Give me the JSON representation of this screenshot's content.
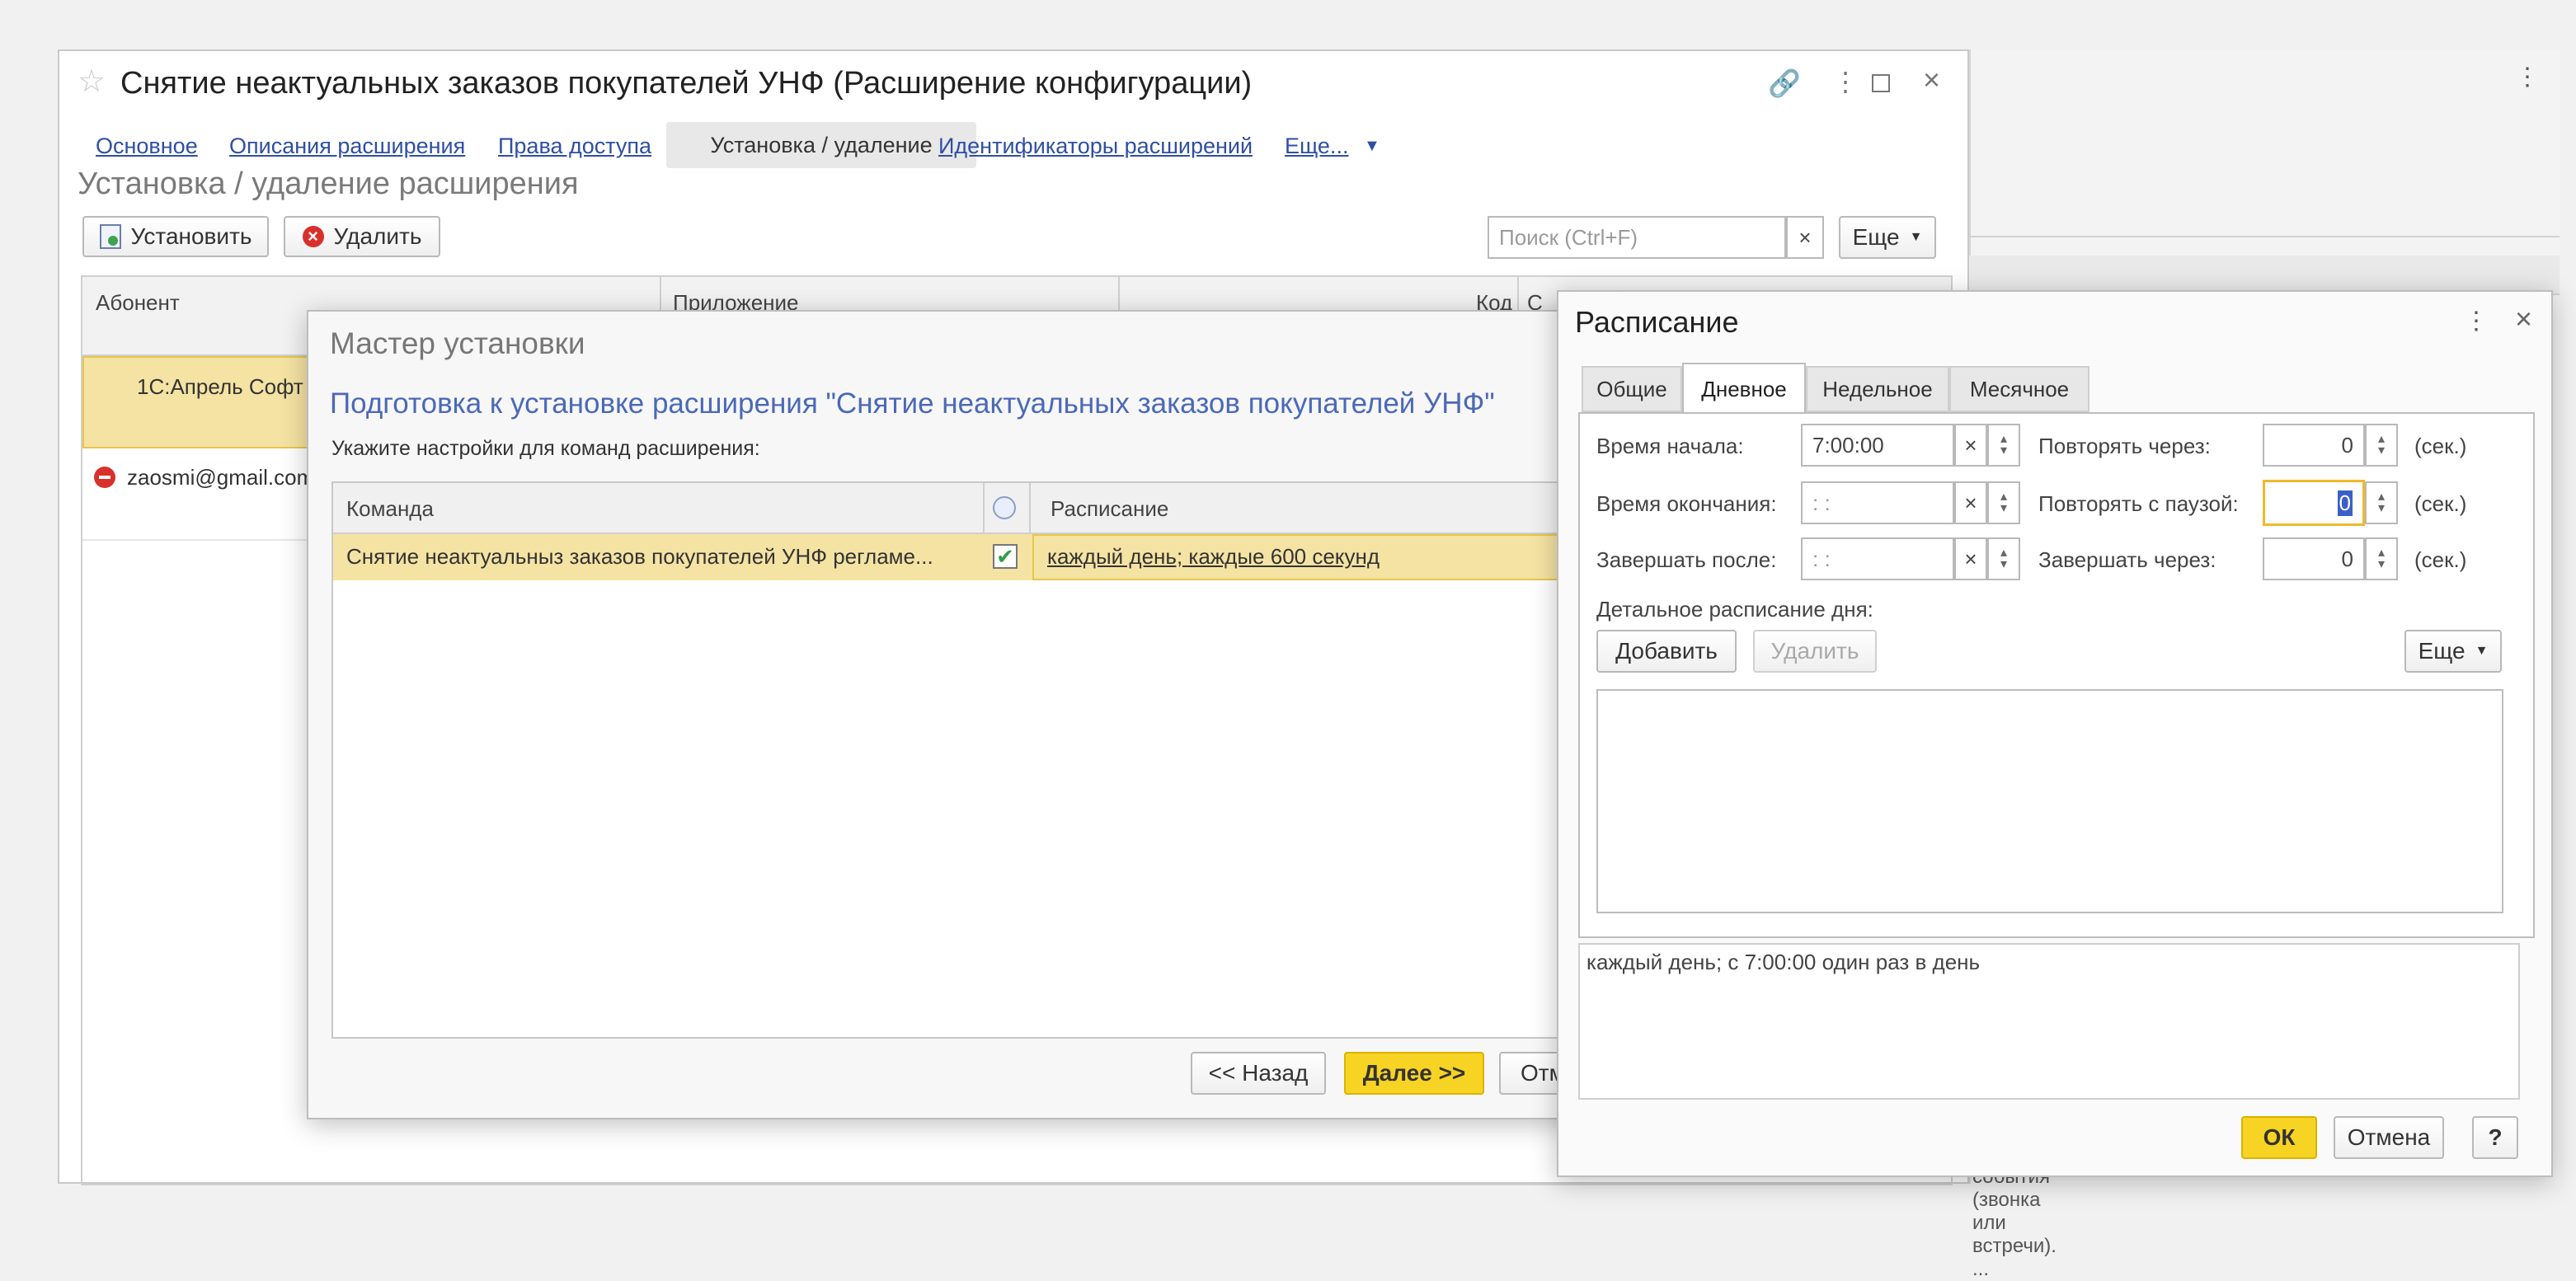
{
  "main": {
    "title": "Снятие неактуальных заказов покупателей УНФ (Расширение конфигурации)",
    "tabs": [
      {
        "label": "Основное"
      },
      {
        "label": "Описания расширения"
      },
      {
        "label": "Права доступа"
      },
      {
        "label": "Установка / удаление"
      },
      {
        "label": "Идентификаторы расширений"
      },
      {
        "label": "Еще..."
      }
    ],
    "section_title": "Установка / удаление расширения",
    "install_label": "Установить",
    "delete_label": "Удалить",
    "search_placeholder": "Поиск (Ctrl+F)",
    "search_clear": "×",
    "more_label": "Еще",
    "columns": [
      "Абонент",
      "Приложение",
      "Код",
      "С"
    ],
    "rows": [
      {
        "subscriber": "1С:Апрель Софт"
      },
      {
        "subscriber": "zaosmi@gmail.com"
      }
    ],
    "bottom_text": "события (звонка или встречи). ..."
  },
  "wizard": {
    "title": "Мастер установки",
    "heading": "Подготовка к установке расширения \"Снятие неактуальных заказов покупателей УНФ\"",
    "instruction": "Укажите настройки для команд расширения:",
    "col_command": "Команда",
    "col_schedule": "Расписание",
    "row_command": "Снятие неактуальныз заказов покупателей УНФ регламе...",
    "row_checked": true,
    "row_schedule": "каждый день; каждые 600 секунд",
    "back_label": "<< Назад",
    "next_label": "Далее >>",
    "cancel_label": "Отм"
  },
  "schedule": {
    "title": "Расписание",
    "tabs": [
      "Общие",
      "Дневное",
      "Недельное",
      "Месячное"
    ],
    "active_tab": "Дневное",
    "start_label": "Время начала:",
    "start_value": "7:00:00",
    "end_label": "Время окончания:",
    "end_value": " :  :",
    "finish_after_label": "Завершать после:",
    "finish_after_value": " :  :",
    "repeat_every_label": "Повторять через:",
    "repeat_every_value": "0",
    "repeat_pause_label": "Повторять с паузой:",
    "repeat_pause_value": "0",
    "finish_in_label": "Завершать через:",
    "finish_in_value": "0",
    "sec_unit": "(сек.)",
    "clear_glyph": "×",
    "detailed_label": "Детальное расписание дня:",
    "add_label": "Добавить",
    "remove_label": "Удалить",
    "more_label": "Еще",
    "summary": "каждый день; с 7:00:00 один раз в день",
    "ok_label": "ОК",
    "cancel_label": "Отмена",
    "help_label": "?"
  },
  "colors": {
    "accent_yellow": "#f7d324",
    "selected_row": "#f5e3a3",
    "link_blue": "#2f4fa3",
    "heading_blue": "#4a69b8"
  }
}
